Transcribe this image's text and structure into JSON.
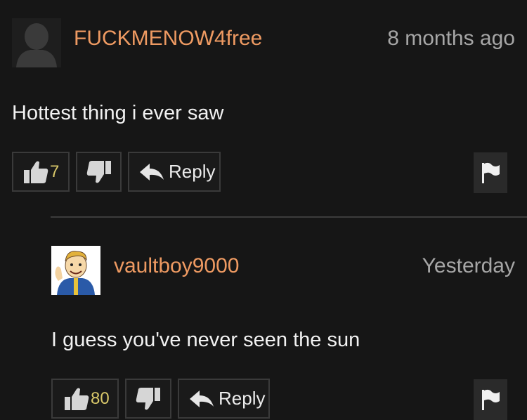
{
  "comments": [
    {
      "username": "FUCKMENOW4free",
      "timestamp": "8 months ago",
      "text": "Hottest thing i ever saw",
      "likes": "7",
      "reply_label": "Reply",
      "avatar_icon": "default-silhouette-icon"
    },
    {
      "username": "vaultboy9000",
      "timestamp": "Yesterday",
      "text": "I guess you've never seen the sun",
      "likes": "80",
      "reply_label": "Reply",
      "avatar_icon": "vault-boy-avatar"
    }
  ],
  "colors": {
    "background": "#161616",
    "username": "#ee9a62",
    "like_count": "#d9c86a",
    "timestamp": "#a6a6a6"
  }
}
